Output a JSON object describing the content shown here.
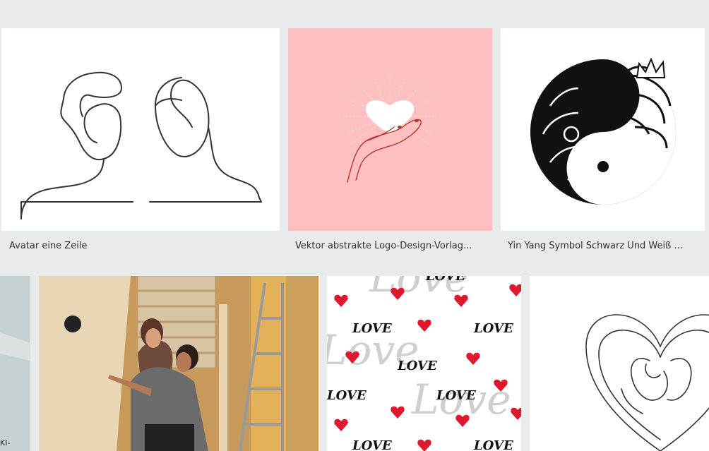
{
  "cards_row1": [
    {
      "caption": "Avatar eine Zeile"
    },
    {
      "caption": "Vektor abstrakte Logo-Design-Vorlag..."
    },
    {
      "caption": "Yin Yang Symbol Schwarz Und Weiß ..."
    }
  ],
  "edge_text": "KI-",
  "love_word": "LOVE",
  "love_script": "Love",
  "colors": {
    "page_bg": "#e8ebec",
    "pink_card": "#fdbfbf",
    "line_art": "#333333",
    "heart_red": "#e0182d"
  }
}
